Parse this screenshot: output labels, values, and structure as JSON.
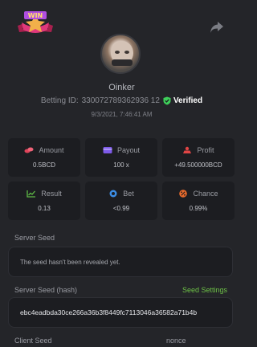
{
  "badge": {
    "text": "WIN",
    "icon": "win-ribbon-icon"
  },
  "header": {
    "share_icon": "share-arrow-icon"
  },
  "user": {
    "name": "Oinker",
    "betting_id_label": "Betting ID:",
    "betting_id": "330072789362936 12",
    "verified_label": "Verified",
    "date": "9/3/2021, 7:46:41 AM"
  },
  "stats": [
    {
      "key": "amount",
      "label": "Amount",
      "value": "0.5BCD",
      "icon": "coins-icon",
      "color": "#e0445a"
    },
    {
      "key": "payout",
      "label": "Payout",
      "value": "100 x",
      "icon": "card-icon",
      "color": "#7d5ae8"
    },
    {
      "key": "profit",
      "label": "Profit",
      "value": "+49.500000BCD",
      "icon": "money-bag-icon",
      "color": "#e04545"
    },
    {
      "key": "result",
      "label": "Result",
      "value": "0.13",
      "icon": "chart-icon",
      "color": "#5fbb46"
    },
    {
      "key": "bet",
      "label": "Bet",
      "value": "<0.99",
      "icon": "chip-icon",
      "color": "#3c8ee6"
    },
    {
      "key": "chance",
      "label": "Chance",
      "value": "0.99%",
      "icon": "percent-icon",
      "color": "#e86a2c"
    }
  ],
  "server_seed": {
    "label": "Server Seed",
    "value": "The seed hasn't been revealed yet."
  },
  "server_seed_hash": {
    "label": "Server Seed (hash)",
    "settings_link": "Seed Settings",
    "value": "ebc4eadbda30ce266a36b3f8449fc7113046a36582a71b4b"
  },
  "client_seed": {
    "label": "Client Seed"
  },
  "nonce": {
    "label": "nonce"
  },
  "colors": {
    "background": "#242529",
    "card": "#1c1d21",
    "accent_green": "#6ec247",
    "verified_green": "#3ecf5a"
  }
}
